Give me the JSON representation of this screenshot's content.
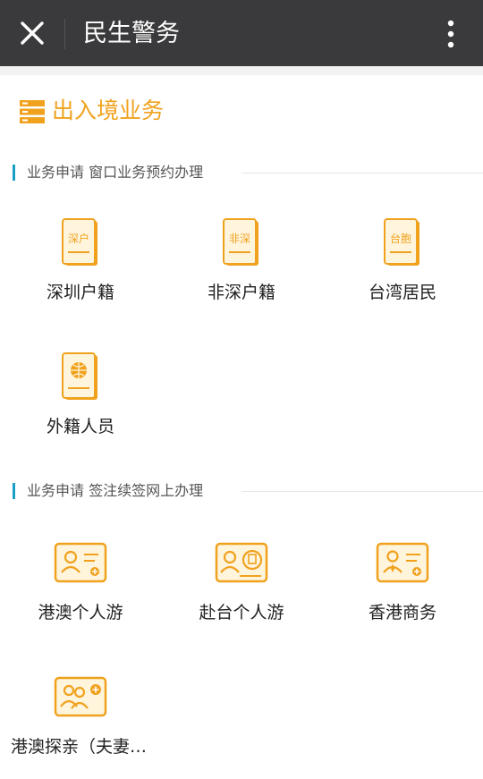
{
  "header": {
    "title": "民生警务",
    "close_icon": "close-icon",
    "more_icon": "more-vertical-icon"
  },
  "page": {
    "title": "出入境业务",
    "icon": "list-menu-icon",
    "accent_color": "#f0a21e"
  },
  "sections": [
    {
      "title": "业务申请 窗口业务预约办理",
      "items": [
        {
          "label": "深圳户籍",
          "icon_text": "深户",
          "icon": "id-card-icon"
        },
        {
          "label": "非深户籍",
          "icon_text": "非深",
          "icon": "id-card-icon"
        },
        {
          "label": "台湾居民",
          "icon_text": "台胞",
          "icon": "id-card-icon"
        },
        {
          "label": "外籍人员",
          "icon": "passport-globe-icon"
        }
      ]
    },
    {
      "title": "业务申请 签注续签网上办理",
      "items": [
        {
          "label": "港澳个人游",
          "icon": "person-card-icon"
        },
        {
          "label": "赴台个人游",
          "icon": "person-card-tw-icon"
        },
        {
          "label": "香港商务",
          "icon": "business-card-icon"
        },
        {
          "label": "港澳探亲（夫妻…",
          "icon": "family-card-icon"
        }
      ]
    }
  ]
}
